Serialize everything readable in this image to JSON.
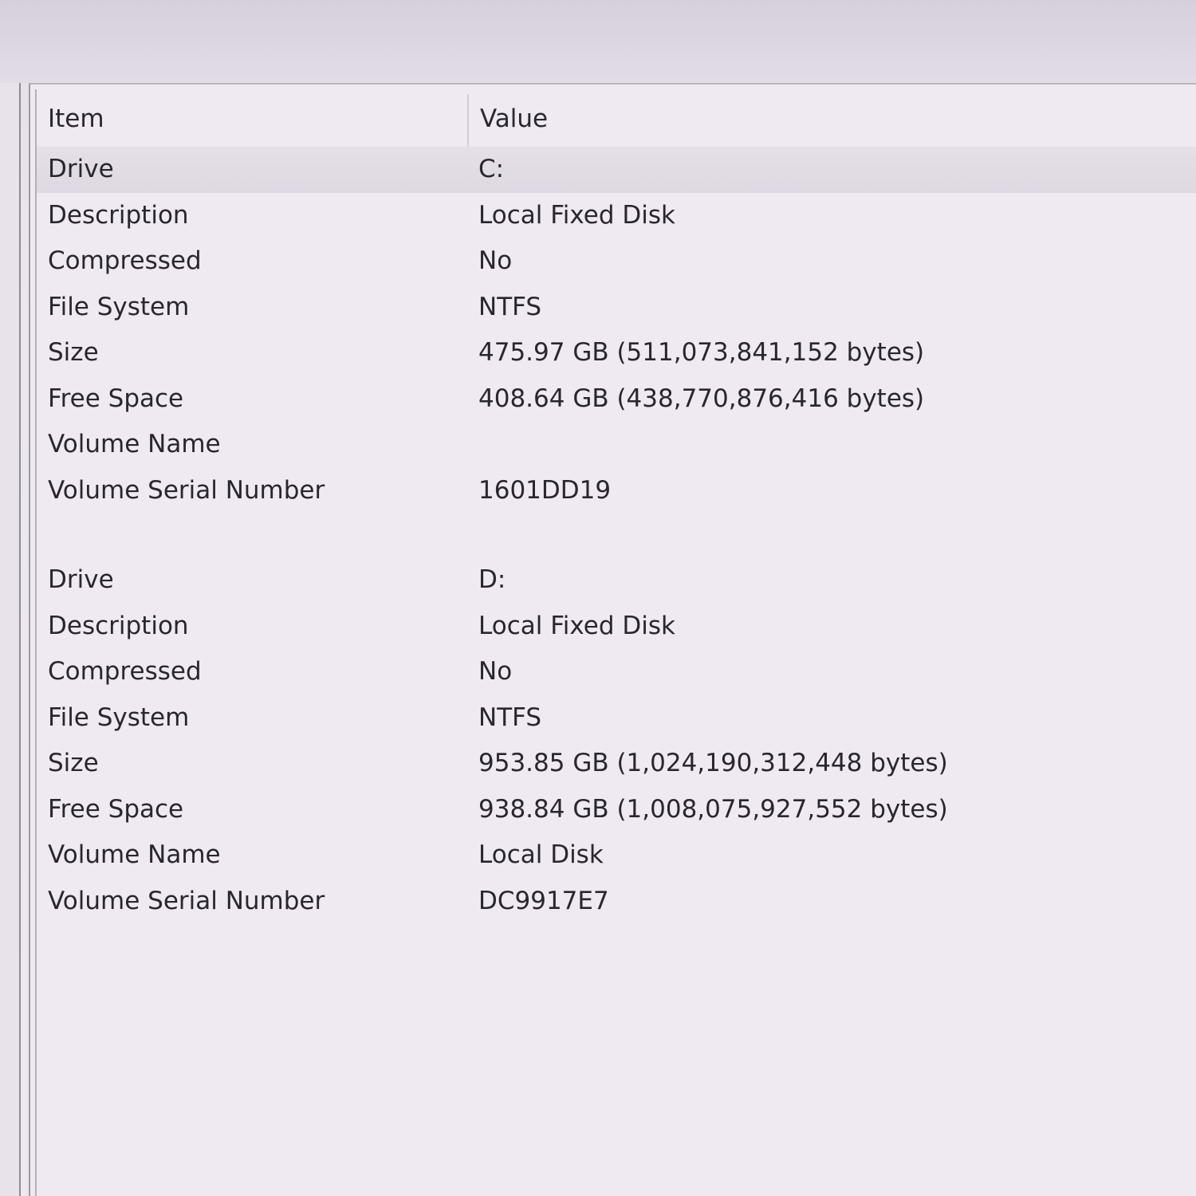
{
  "columns": {
    "item": "Item",
    "value": "Value"
  },
  "drives": [
    {
      "rows": [
        {
          "item": "Drive",
          "value": "C:"
        },
        {
          "item": "Description",
          "value": "Local Fixed Disk"
        },
        {
          "item": "Compressed",
          "value": "No"
        },
        {
          "item": "File System",
          "value": "NTFS"
        },
        {
          "item": "Size",
          "value": "475.97 GB (511,073,841,152 bytes)"
        },
        {
          "item": "Free Space",
          "value": "408.64 GB (438,770,876,416 bytes)"
        },
        {
          "item": "Volume Name",
          "value": ""
        },
        {
          "item": "Volume Serial Number",
          "value": "1601DD19"
        }
      ]
    },
    {
      "rows": [
        {
          "item": "Drive",
          "value": "D:"
        },
        {
          "item": "Description",
          "value": "Local Fixed Disk"
        },
        {
          "item": "Compressed",
          "value": "No"
        },
        {
          "item": "File System",
          "value": "NTFS"
        },
        {
          "item": "Size",
          "value": "953.85 GB (1,024,190,312,448 bytes)"
        },
        {
          "item": "Free Space",
          "value": "938.84 GB (1,008,075,927,552 bytes)"
        },
        {
          "item": "Volume Name",
          "value": "Local Disk"
        },
        {
          "item": "Volume Serial Number",
          "value": "DC9917E7"
        }
      ]
    }
  ]
}
